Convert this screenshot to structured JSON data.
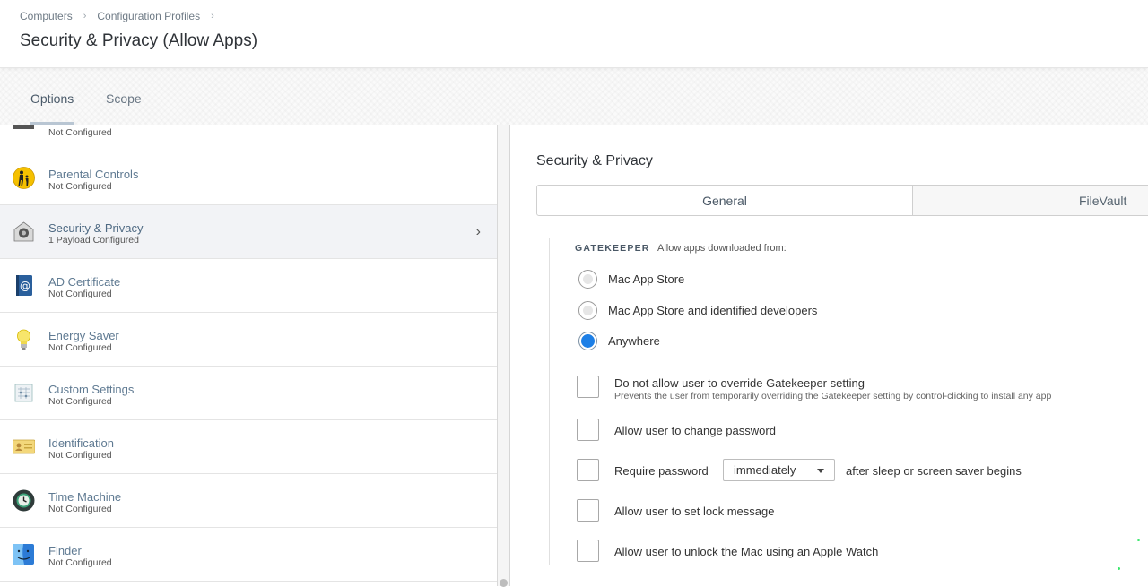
{
  "breadcrumb": {
    "items": [
      "Computers",
      "Configuration Profiles"
    ],
    "separator": "›"
  },
  "page_title": "Security & Privacy (Allow Apps)",
  "tabs": [
    {
      "label": "Options",
      "active": true
    },
    {
      "label": "Scope",
      "active": false
    }
  ],
  "payloads": [
    {
      "name": "",
      "status": "Not Configured",
      "icon": "printer-icon"
    },
    {
      "name": "Parental Controls",
      "status": "Not Configured",
      "icon": "parental-controls-icon"
    },
    {
      "name": "Security & Privacy",
      "status": "1 Payload Configured",
      "icon": "security-privacy-icon",
      "selected": true
    },
    {
      "name": "AD Certificate",
      "status": "Not Configured",
      "icon": "ad-certificate-icon"
    },
    {
      "name": "Energy Saver",
      "status": "Not Configured",
      "icon": "energy-saver-icon"
    },
    {
      "name": "Custom Settings",
      "status": "Not Configured",
      "icon": "custom-settings-icon"
    },
    {
      "name": "Identification",
      "status": "Not Configured",
      "icon": "identification-icon"
    },
    {
      "name": "Time Machine",
      "status": "Not Configured",
      "icon": "time-machine-icon"
    },
    {
      "name": "Finder",
      "status": "Not Configured",
      "icon": "finder-icon"
    }
  ],
  "detail": {
    "section_title": "Security & Privacy",
    "segments": [
      {
        "label": "General",
        "active": true
      },
      {
        "label": "FileVault",
        "active": false
      }
    ],
    "gatekeeper": {
      "label": "GATEKEEPER",
      "description": "Allow apps downloaded from:",
      "options": [
        {
          "label": "Mac App Store",
          "selected": false
        },
        {
          "label": "Mac App Store and identified developers",
          "selected": false
        },
        {
          "label": "Anywhere",
          "selected": true
        }
      ]
    },
    "options": [
      {
        "label": "Do not allow user to override Gatekeeper setting",
        "help": "Prevents the user from temporarily overriding the Gatekeeper setting by control-clicking to install any app",
        "checked": false
      },
      {
        "label": "Allow user to change password",
        "checked": false
      },
      {
        "label": "Require password",
        "checked": false
      },
      {
        "label": "Allow user to set lock message",
        "checked": false
      },
      {
        "label": "Allow user to unlock the Mac using an Apple Watch",
        "checked": false
      }
    ],
    "require_password_select": "immediately",
    "require_password_suffix": "after sleep or screen saver begins"
  },
  "colors": {
    "accent": "#1d7fe6",
    "link": "#5f7a92",
    "selected_row": "#f2f3f6"
  }
}
